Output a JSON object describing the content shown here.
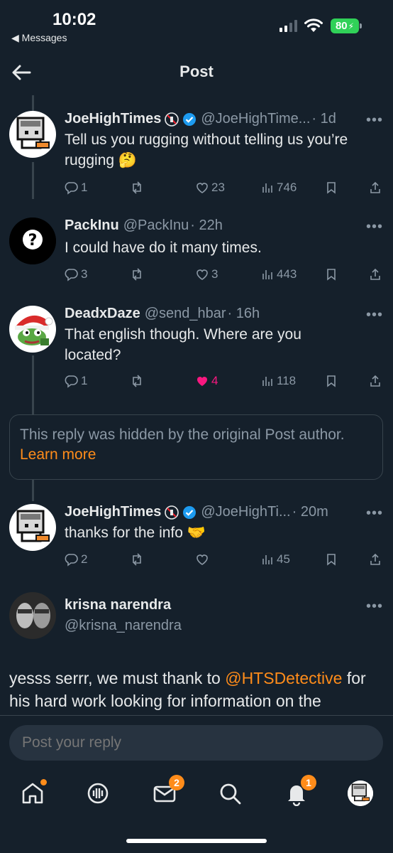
{
  "status_bar": {
    "time": "10:02",
    "back_app": "◀ Messages",
    "battery": "80"
  },
  "header": {
    "title": "Post"
  },
  "replies": [
    {
      "name": "JoeHighTimes",
      "handle": "@JoeHighTime...",
      "time": "· 1d",
      "text": "Tell us you rugging without telling us you’re rugging 🤔",
      "replies": "1",
      "likes": "23",
      "views": "746",
      "liked": false
    },
    {
      "name": "PackInu",
      "handle": "@PackInu",
      "time": "· 22h",
      "text": "I could have do it many times.",
      "replies": "3",
      "likes": "3",
      "views": "443",
      "liked": false
    },
    {
      "name": "DeadxDaze",
      "handle": "@send_hbar",
      "time": "· 16h",
      "text": "That english though. Where are you located?",
      "replies": "1",
      "likes": "4",
      "views": "118",
      "liked": true
    },
    {
      "name": "JoeHighTimes",
      "handle": "@JoeHighTi...",
      "time": "· 20m",
      "text": "thanks for the info 🤝",
      "replies": "2",
      "likes": "",
      "views": "45",
      "liked": false
    }
  ],
  "hidden_notice": {
    "text": "This reply was hidden by the original Post author.",
    "link": "Learn more"
  },
  "main_post": {
    "name": "krisna narendra",
    "handle": "@krisna_narendra",
    "text_before": "yesss serrr, we must thank to ",
    "mention": "@HTSDetective",
    "text_after": " for his hard work looking for information on the"
  },
  "reply_box": {
    "placeholder": "Post your reply"
  },
  "tabbar": {
    "messages_badge": "2",
    "notifications_badge": "1"
  },
  "colors": {
    "background": "#15202b",
    "accent": "#ff8c1a",
    "like": "#f91880",
    "verified": "#1d9bf0"
  }
}
